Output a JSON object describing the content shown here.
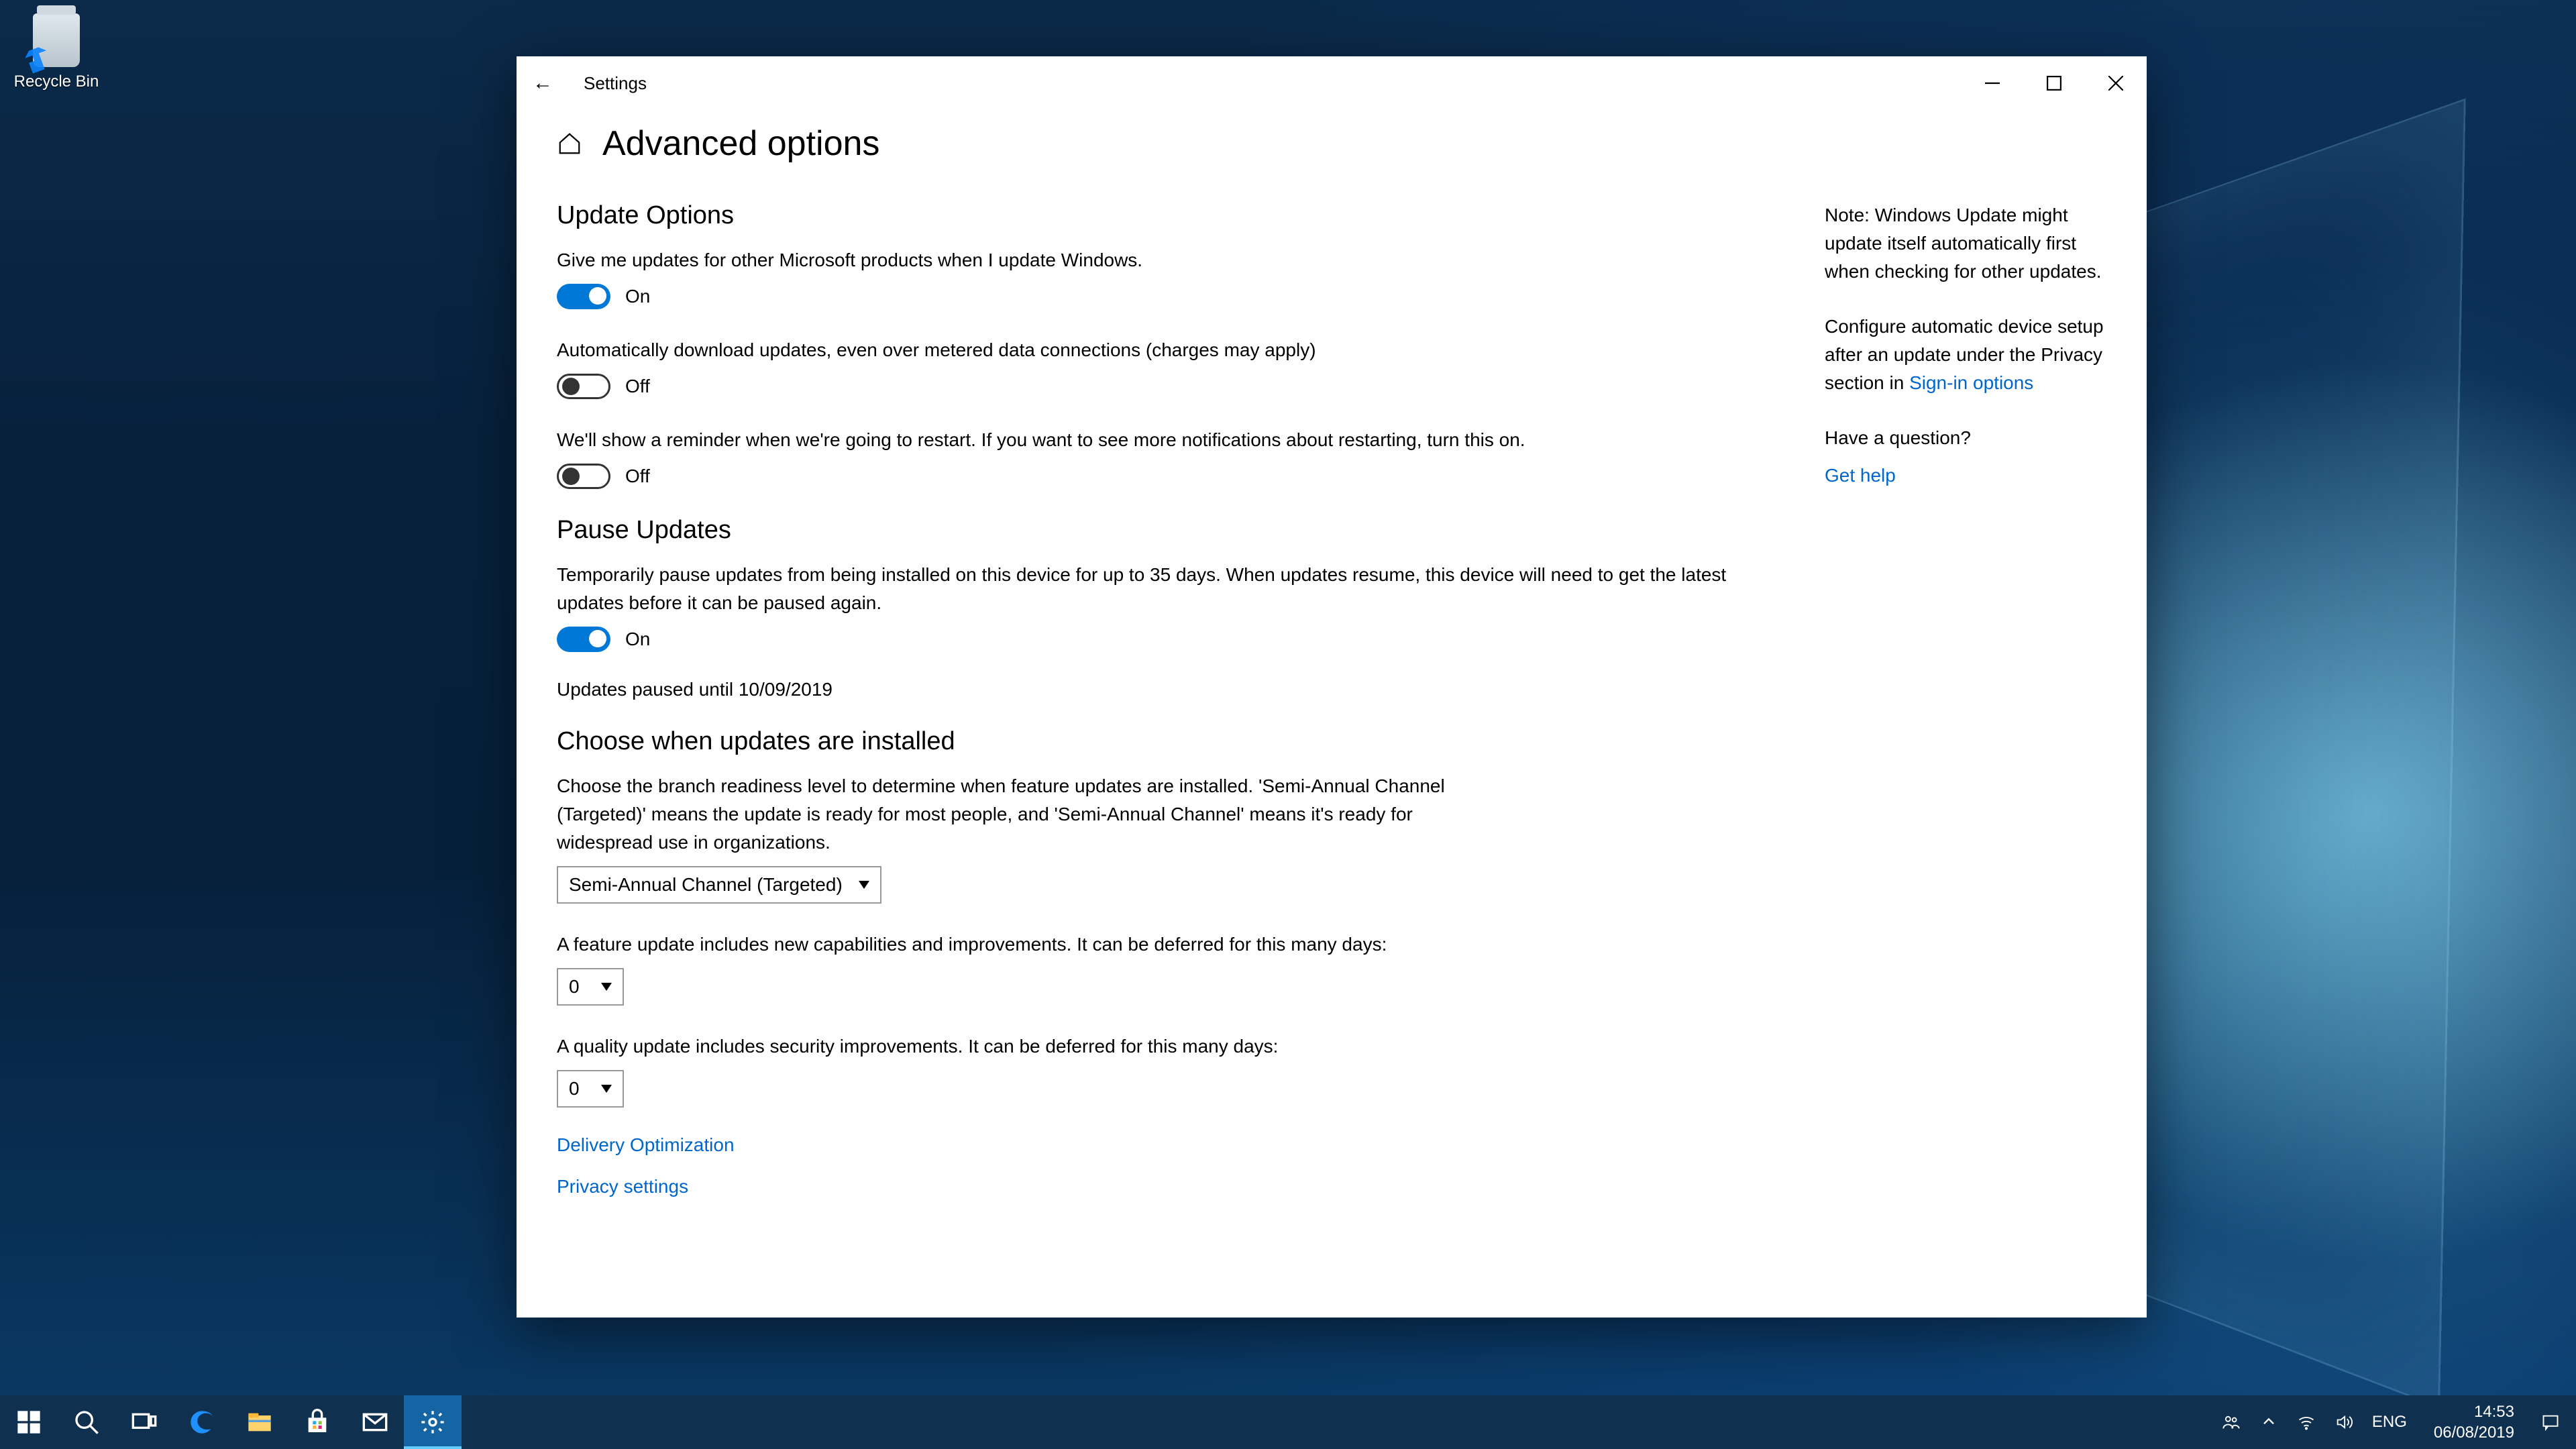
{
  "desktop": {
    "recycle_bin_label": "Recycle Bin"
  },
  "window": {
    "app_title": "Settings",
    "page_title": "Advanced options"
  },
  "sections": {
    "update_options": {
      "heading": "Update Options",
      "opt1_label": "Give me updates for other Microsoft products when I update Windows.",
      "opt1_state": "On",
      "opt1_on": true,
      "opt2_label": "Automatically download updates, even over metered data connections (charges may apply)",
      "opt2_state": "Off",
      "opt2_on": false,
      "opt3_label": "We'll show a reminder when we're going to restart. If you want to see more notifications about restarting, turn this on.",
      "opt3_state": "Off",
      "opt3_on": false
    },
    "pause_updates": {
      "heading": "Pause Updates",
      "desc": "Temporarily pause updates from being installed on this device for up to 35 days. When updates resume, this device will need to get the latest updates before it can be paused again.",
      "toggle_state": "On",
      "toggle_on": true,
      "paused_until": "Updates paused until 10/09/2019"
    },
    "choose_when": {
      "heading": "Choose when updates are installed",
      "desc": "Choose the branch readiness level to determine when feature updates are installed. 'Semi-Annual Channel (Targeted)' means the update is ready for most people, and 'Semi-Annual Channel' means it's ready for widespread use in organizations.",
      "branch_value": "Semi-Annual Channel (Targeted)",
      "feature_label": "A feature update includes new capabilities and improvements. It can be deferred for this many days:",
      "feature_value": "0",
      "quality_label": "A quality update includes security improvements. It can be deferred for this many days:",
      "quality_value": "0"
    },
    "links": {
      "delivery": "Delivery Optimization",
      "privacy": "Privacy settings"
    }
  },
  "sidebar": {
    "note": "Note: Windows Update might update itself automatically first when checking for other updates.",
    "config_pre": "Configure automatic device setup after an update under the Privacy section in ",
    "config_link": "Sign-in options",
    "question": "Have a question?",
    "get_help": "Get help"
  },
  "taskbar": {
    "lang": "ENG",
    "time": "14:53",
    "date": "06/08/2019"
  }
}
